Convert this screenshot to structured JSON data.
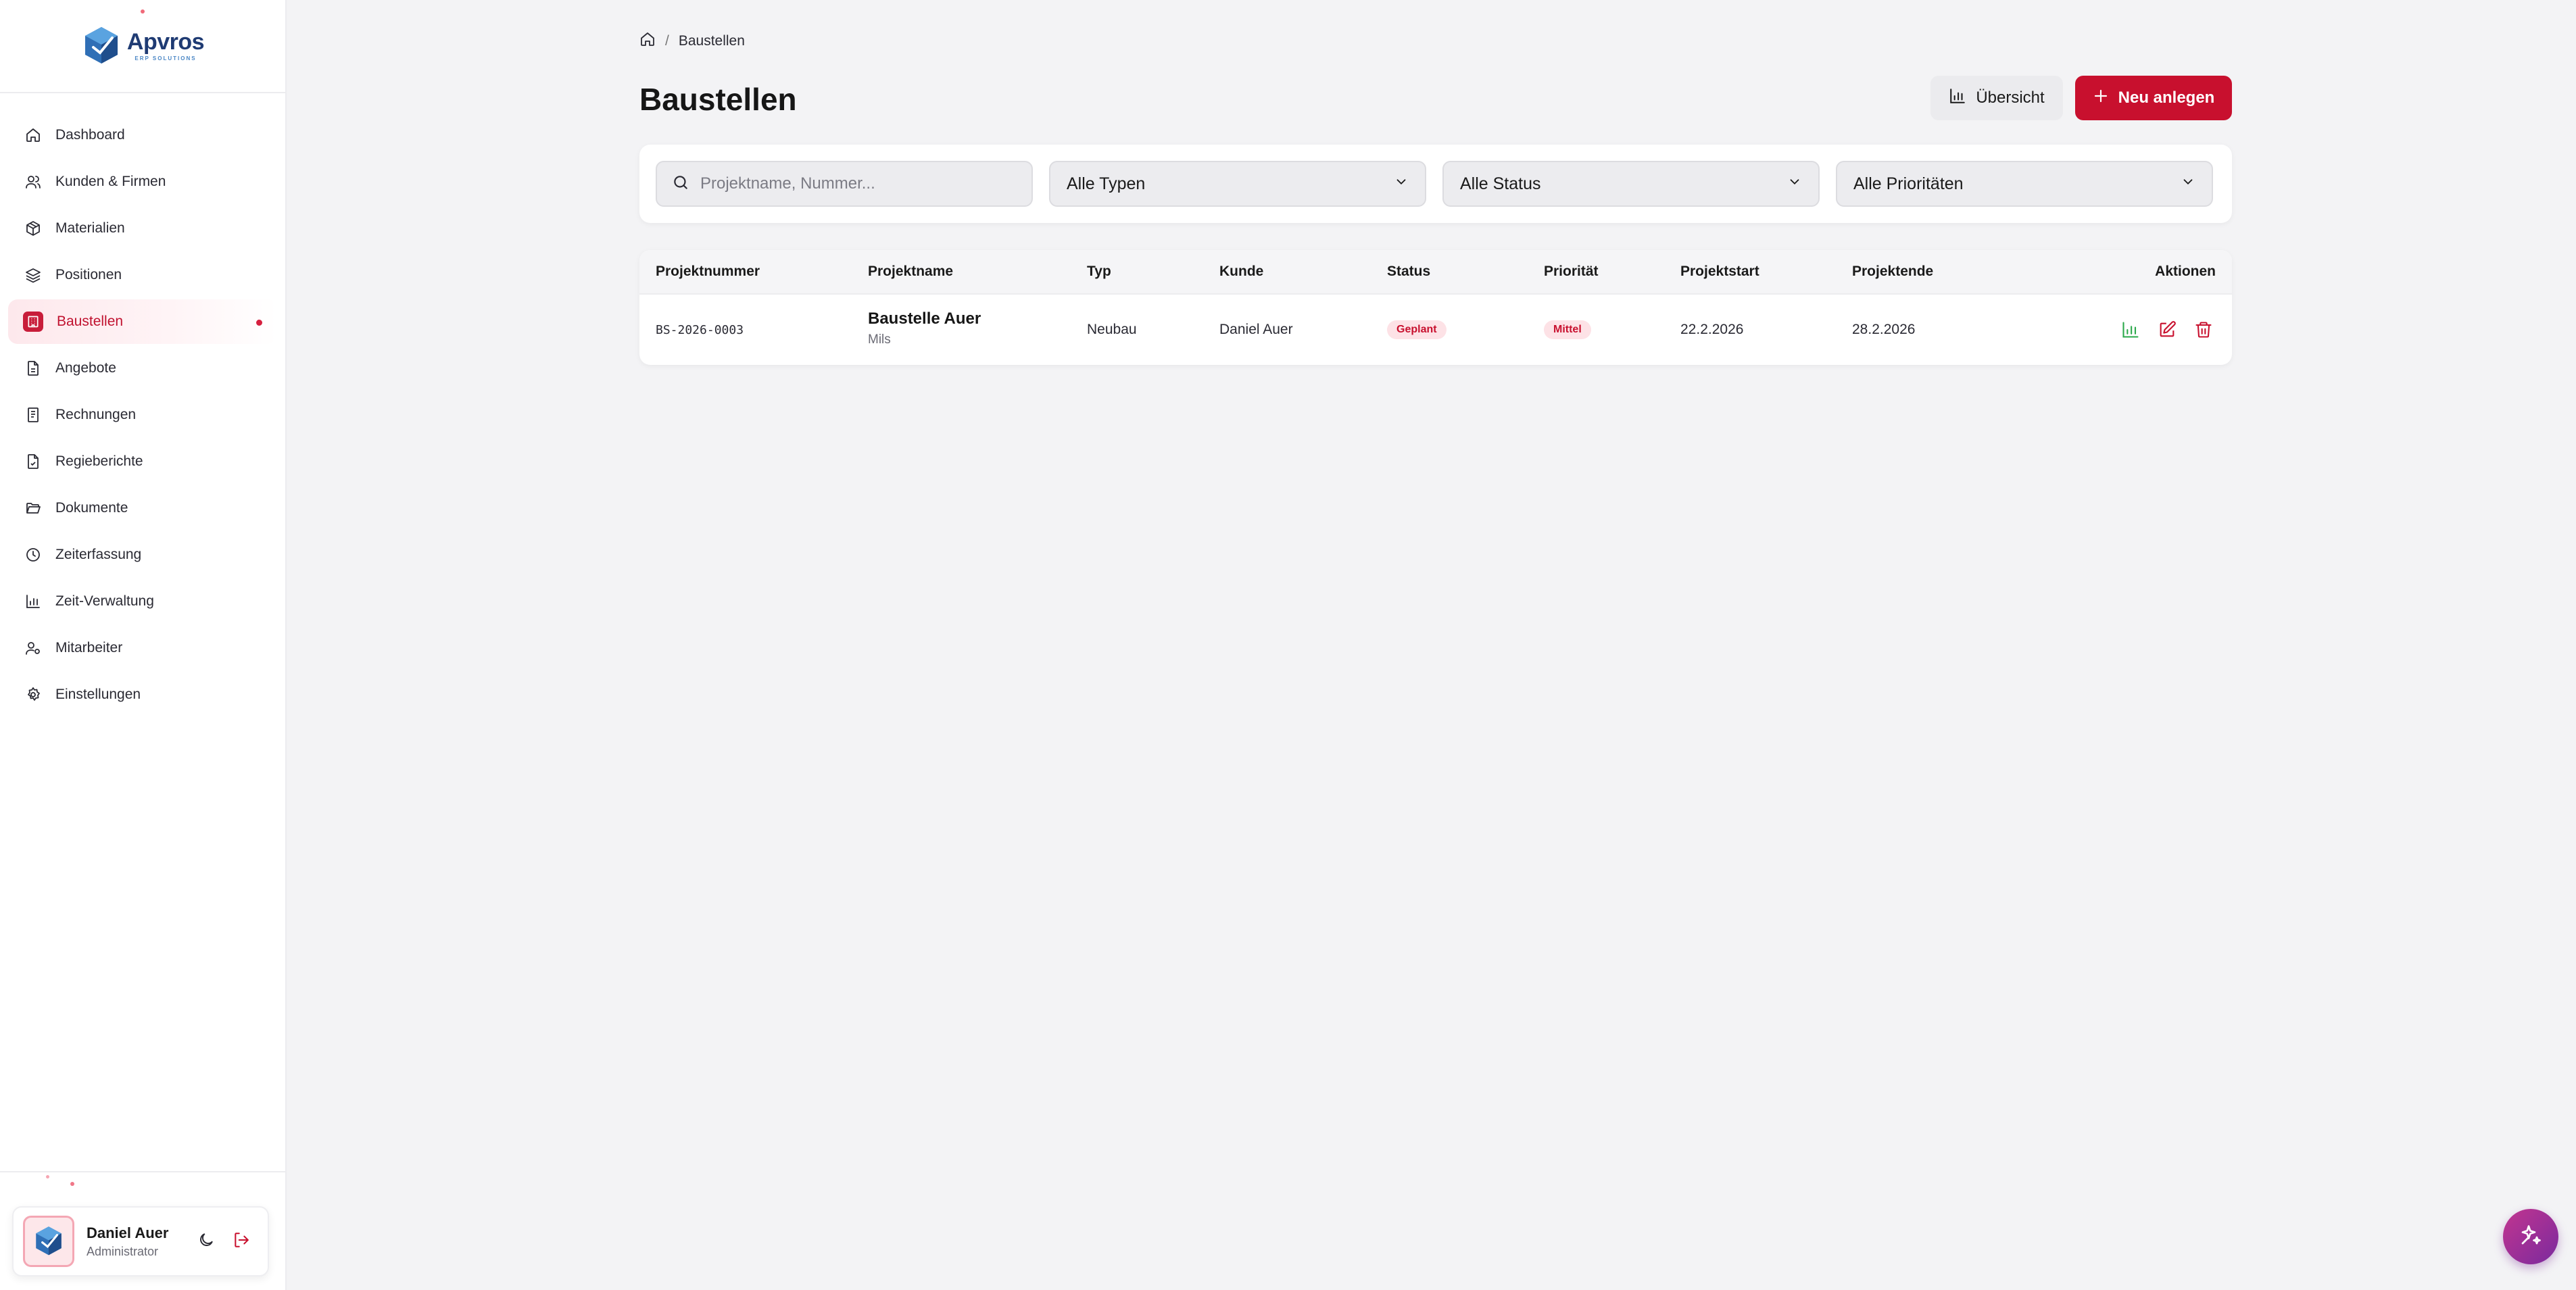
{
  "app": {
    "brand_name": "Apvros",
    "brand_tagline": "ERP SOLUTIONS"
  },
  "sidebar": {
    "items": [
      {
        "label": "Dashboard",
        "icon": "home-icon"
      },
      {
        "label": "Kunden & Firmen",
        "icon": "users-icon"
      },
      {
        "label": "Materialien",
        "icon": "package-icon"
      },
      {
        "label": "Positionen",
        "icon": "layers-icon"
      },
      {
        "label": "Baustellen",
        "icon": "building-icon",
        "active": true
      },
      {
        "label": "Angebote",
        "icon": "file-text-icon"
      },
      {
        "label": "Rechnungen",
        "icon": "receipt-icon"
      },
      {
        "label": "Regieberichte",
        "icon": "file-check-icon"
      },
      {
        "label": "Dokumente",
        "icon": "folder-open-icon"
      },
      {
        "label": "Zeiterfassung",
        "icon": "clock-icon"
      },
      {
        "label": "Zeit-Verwaltung",
        "icon": "bar-chart-icon"
      },
      {
        "label": "Mitarbeiter",
        "icon": "user-cog-icon"
      },
      {
        "label": "Einstellungen",
        "icon": "gear-icon"
      }
    ]
  },
  "user": {
    "name": "Daniel Auer",
    "role": "Administrator"
  },
  "breadcrumb": {
    "current": "Baustellen",
    "separator": "/"
  },
  "header": {
    "title": "Baustellen",
    "overview_label": "Übersicht",
    "new_label": "Neu anlegen"
  },
  "filters": {
    "search_placeholder": "Projektname, Nummer...",
    "type": "Alle Typen",
    "status": "Alle Status",
    "priority": "Alle Prioritäten"
  },
  "table": {
    "columns": [
      "Projektnummer",
      "Projektname",
      "Typ",
      "Kunde",
      "Status",
      "Priorität",
      "Projektstart",
      "Projektende",
      "Aktionen"
    ],
    "rows": [
      {
        "number": "BS-2026-0003",
        "name": "Baustelle Auer",
        "location": "Mils",
        "type": "Neubau",
        "customer": "Daniel Auer",
        "status": "Geplant",
        "priority": "Mittel",
        "start": "22.2.2026",
        "end": "28.2.2026"
      }
    ]
  },
  "colors": {
    "accent": "#c8102e",
    "badge_bg": "#fde2e6",
    "chart_action": "#2aa84a",
    "fab_start": "#c2358f",
    "fab_end": "#7a2a9e"
  }
}
